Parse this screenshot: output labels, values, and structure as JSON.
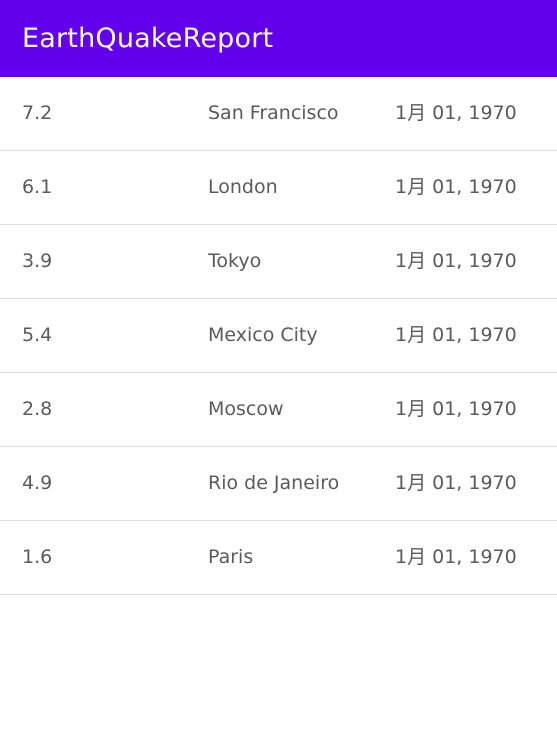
{
  "app_bar": {
    "title": "EarthQuakeReport",
    "color": "#6200EE"
  },
  "quakes": [
    {
      "magnitude": "7.2",
      "location": "San Francisco",
      "date": "1月 01, 1970"
    },
    {
      "magnitude": "6.1",
      "location": "London",
      "date": "1月 01, 1970"
    },
    {
      "magnitude": "3.9",
      "location": "Tokyo",
      "date": "1月 01, 1970"
    },
    {
      "magnitude": "5.4",
      "location": "Mexico City",
      "date": "1月 01, 1970"
    },
    {
      "magnitude": "2.8",
      "location": "Moscow",
      "date": "1月 01, 1970"
    },
    {
      "magnitude": "4.9",
      "location": "Rio de Janeiro",
      "date": "1月 01, 1970"
    },
    {
      "magnitude": "1.6",
      "location": "Paris",
      "date": "1月 01, 1970"
    }
  ]
}
